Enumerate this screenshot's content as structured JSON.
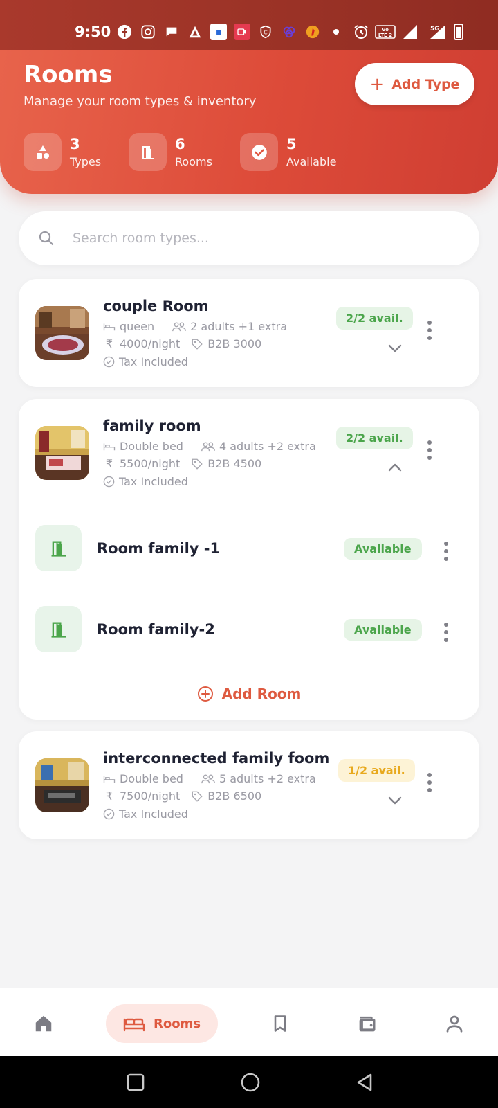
{
  "status_bar": {
    "time": "9:50",
    "network_label": "5G",
    "lte_label": "LTE 2"
  },
  "header": {
    "title": "Rooms",
    "subtitle": "Manage your room types & inventory",
    "add_type_label": "Add Type",
    "stats": [
      {
        "value": "3",
        "label": "Types",
        "icon": "shapes-icon"
      },
      {
        "value": "6",
        "label": "Rooms",
        "icon": "door-icon"
      },
      {
        "value": "5",
        "label": "Available",
        "icon": "check-circle-icon"
      }
    ]
  },
  "search": {
    "placeholder": "Search room types..."
  },
  "room_types": [
    {
      "name": "couple Room",
      "bed": "queen",
      "guests": "2 adults +1 extra",
      "price": "4000/night",
      "b2b": "B2B 3000",
      "tax": "Tax Included",
      "availability": "2/2 avail.",
      "availability_status": "green",
      "expanded": false
    },
    {
      "name": "family room",
      "bed": "Double bed",
      "guests": "4 adults +2 extra",
      "price": "5500/night",
      "b2b": "B2B 4500",
      "tax": "Tax Included",
      "availability": "2/2 avail.",
      "availability_status": "green",
      "expanded": true,
      "rooms": [
        {
          "name": "Room family -1",
          "status": "Available"
        },
        {
          "name": "Room family-2",
          "status": "Available"
        }
      ],
      "add_room_label": "Add Room"
    },
    {
      "name": "interconnected family foom",
      "bed": "Double bed",
      "guests": "5 adults +2 extra",
      "price": "7500/night",
      "b2b": "B2B 6500",
      "tax": "Tax Included",
      "availability": "1/2 avail.",
      "availability_status": "yellow",
      "expanded": false
    }
  ],
  "bottom_nav": {
    "items": [
      {
        "icon": "home-icon",
        "label": ""
      },
      {
        "icon": "bed-icon",
        "label": "Rooms",
        "active": true
      },
      {
        "icon": "bookmark-icon",
        "label": ""
      },
      {
        "icon": "wallet-icon",
        "label": ""
      },
      {
        "icon": "profile-icon",
        "label": ""
      }
    ]
  },
  "colors": {
    "accent": "#de5a40",
    "success": "#4ba54b",
    "warning": "#e8a91d",
    "header_start": "#e8644c",
    "header_end": "#cf3e32"
  }
}
